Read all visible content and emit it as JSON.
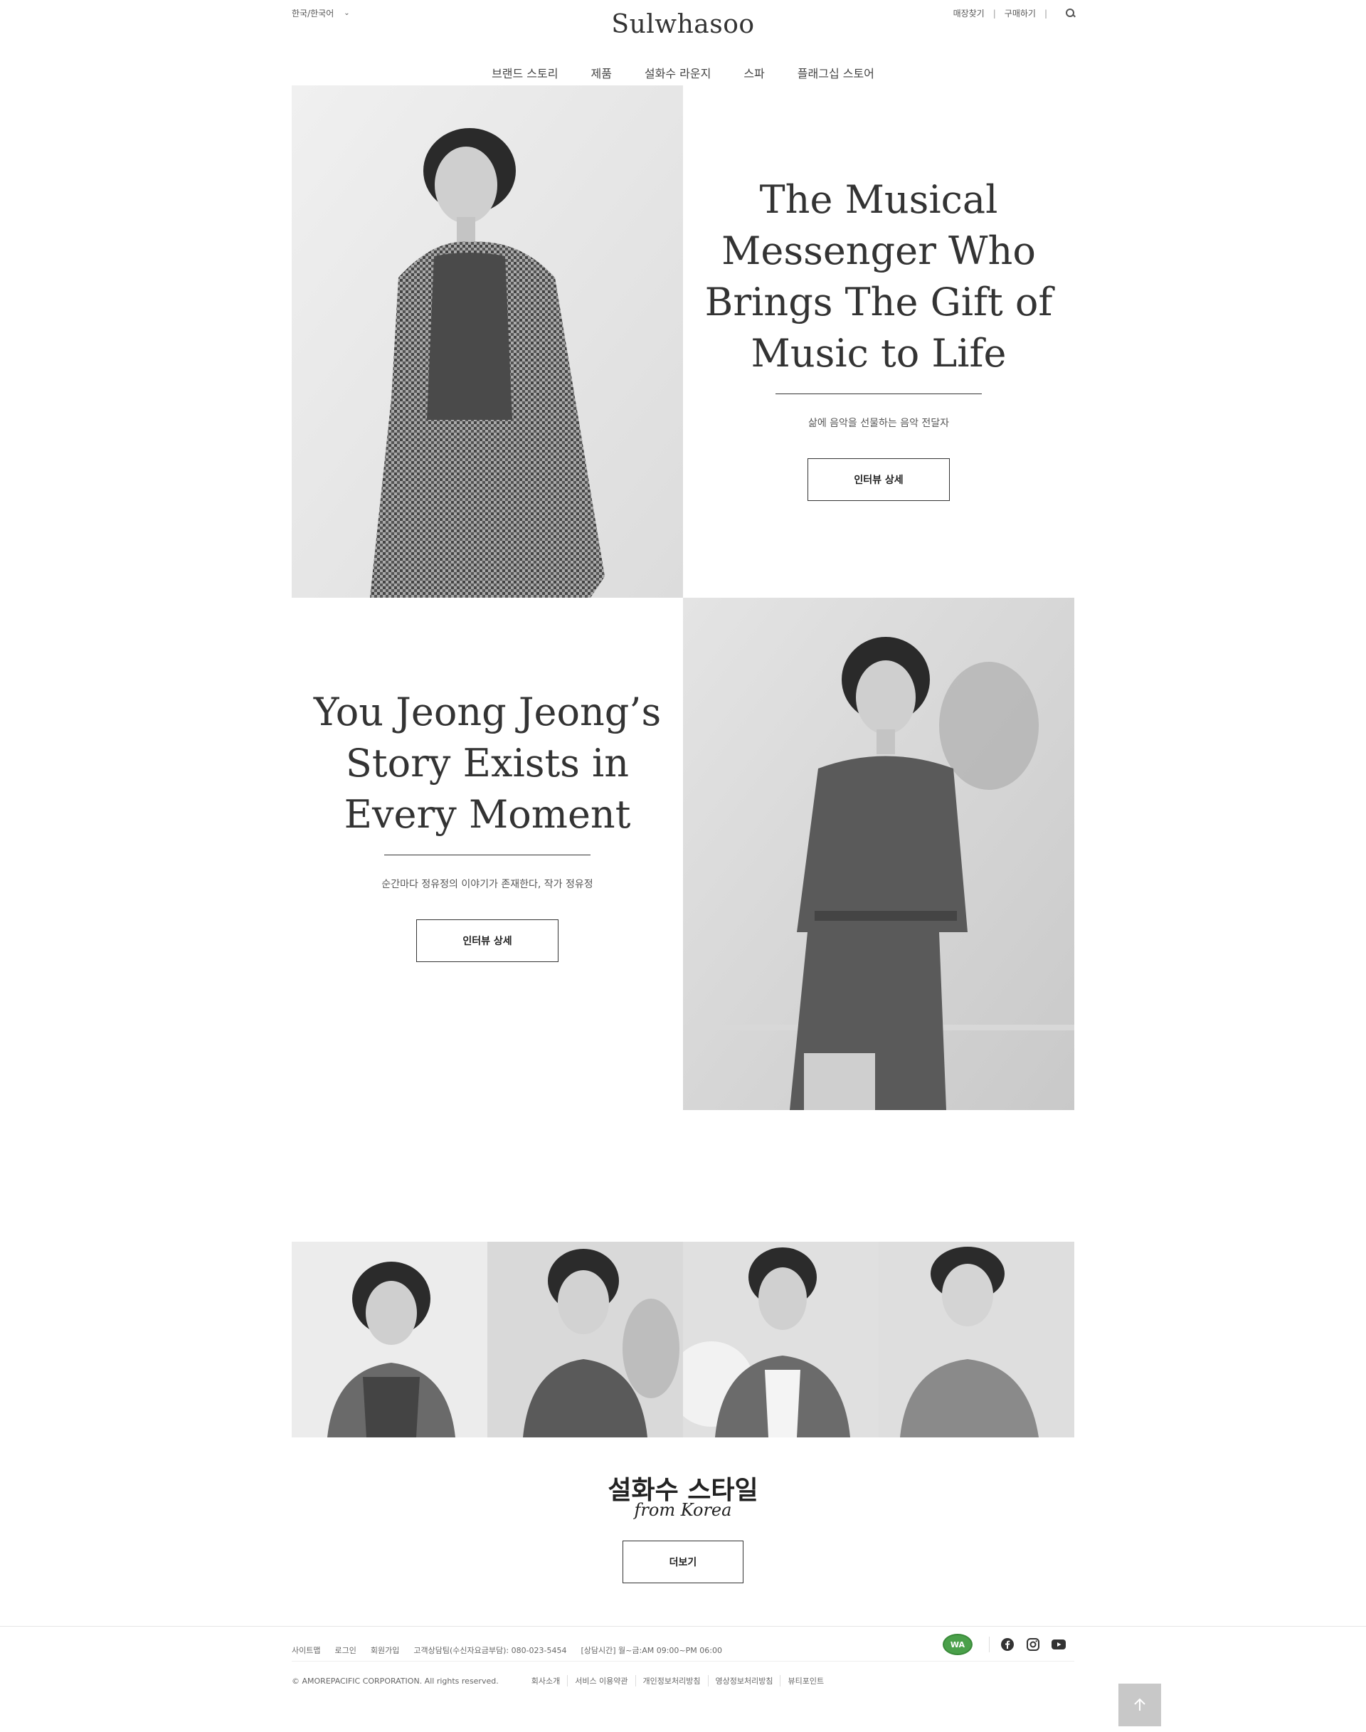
{
  "header": {
    "language": "한국/한국어",
    "logo": "Sulwhasoo",
    "util": {
      "store_finder": "매장찾기",
      "purchase": "구매하기"
    }
  },
  "nav": [
    "브랜드 스토리",
    "제품",
    "설화수 라운지",
    "스파",
    "플래그십 스토어"
  ],
  "features": [
    {
      "title": "The Musical Messenger Who Brings The Gift of Music to Life",
      "subtitle": "삶에 음악을 선물하는 음악 전달자",
      "button": "인터뷰 상세"
    },
    {
      "title": "You Jeong Jeong’s Story Exists in Every Moment",
      "subtitle": "순간마다 정유정의 이야기가 존재한다, 작가 정유정",
      "button": "인터뷰 상세"
    }
  ],
  "style_section": {
    "title": "설화수 스타일",
    "subtitle": "from Korea",
    "button": "더보기"
  },
  "footer": {
    "links": [
      "사이트맵",
      "로그인",
      "회원가입",
      "고객상담팀(수신자요금부담): 080-023-5454",
      "[상담시간] 월~금:AM 09:00~PM 06:00"
    ],
    "copyright": "© AMOREPACIFIC CORPORATION. All rights reserved.",
    "policy_links": [
      "회사소개",
      "서비스 이용약관",
      "개인정보처리방침",
      "영상정보처리방침",
      "뷰티포인트"
    ],
    "badge": "WA"
  },
  "icons": {
    "search": "search-icon",
    "facebook": "facebook-icon",
    "instagram": "instagram-icon",
    "youtube": "youtube-icon",
    "top": "arrow-up-icon"
  }
}
